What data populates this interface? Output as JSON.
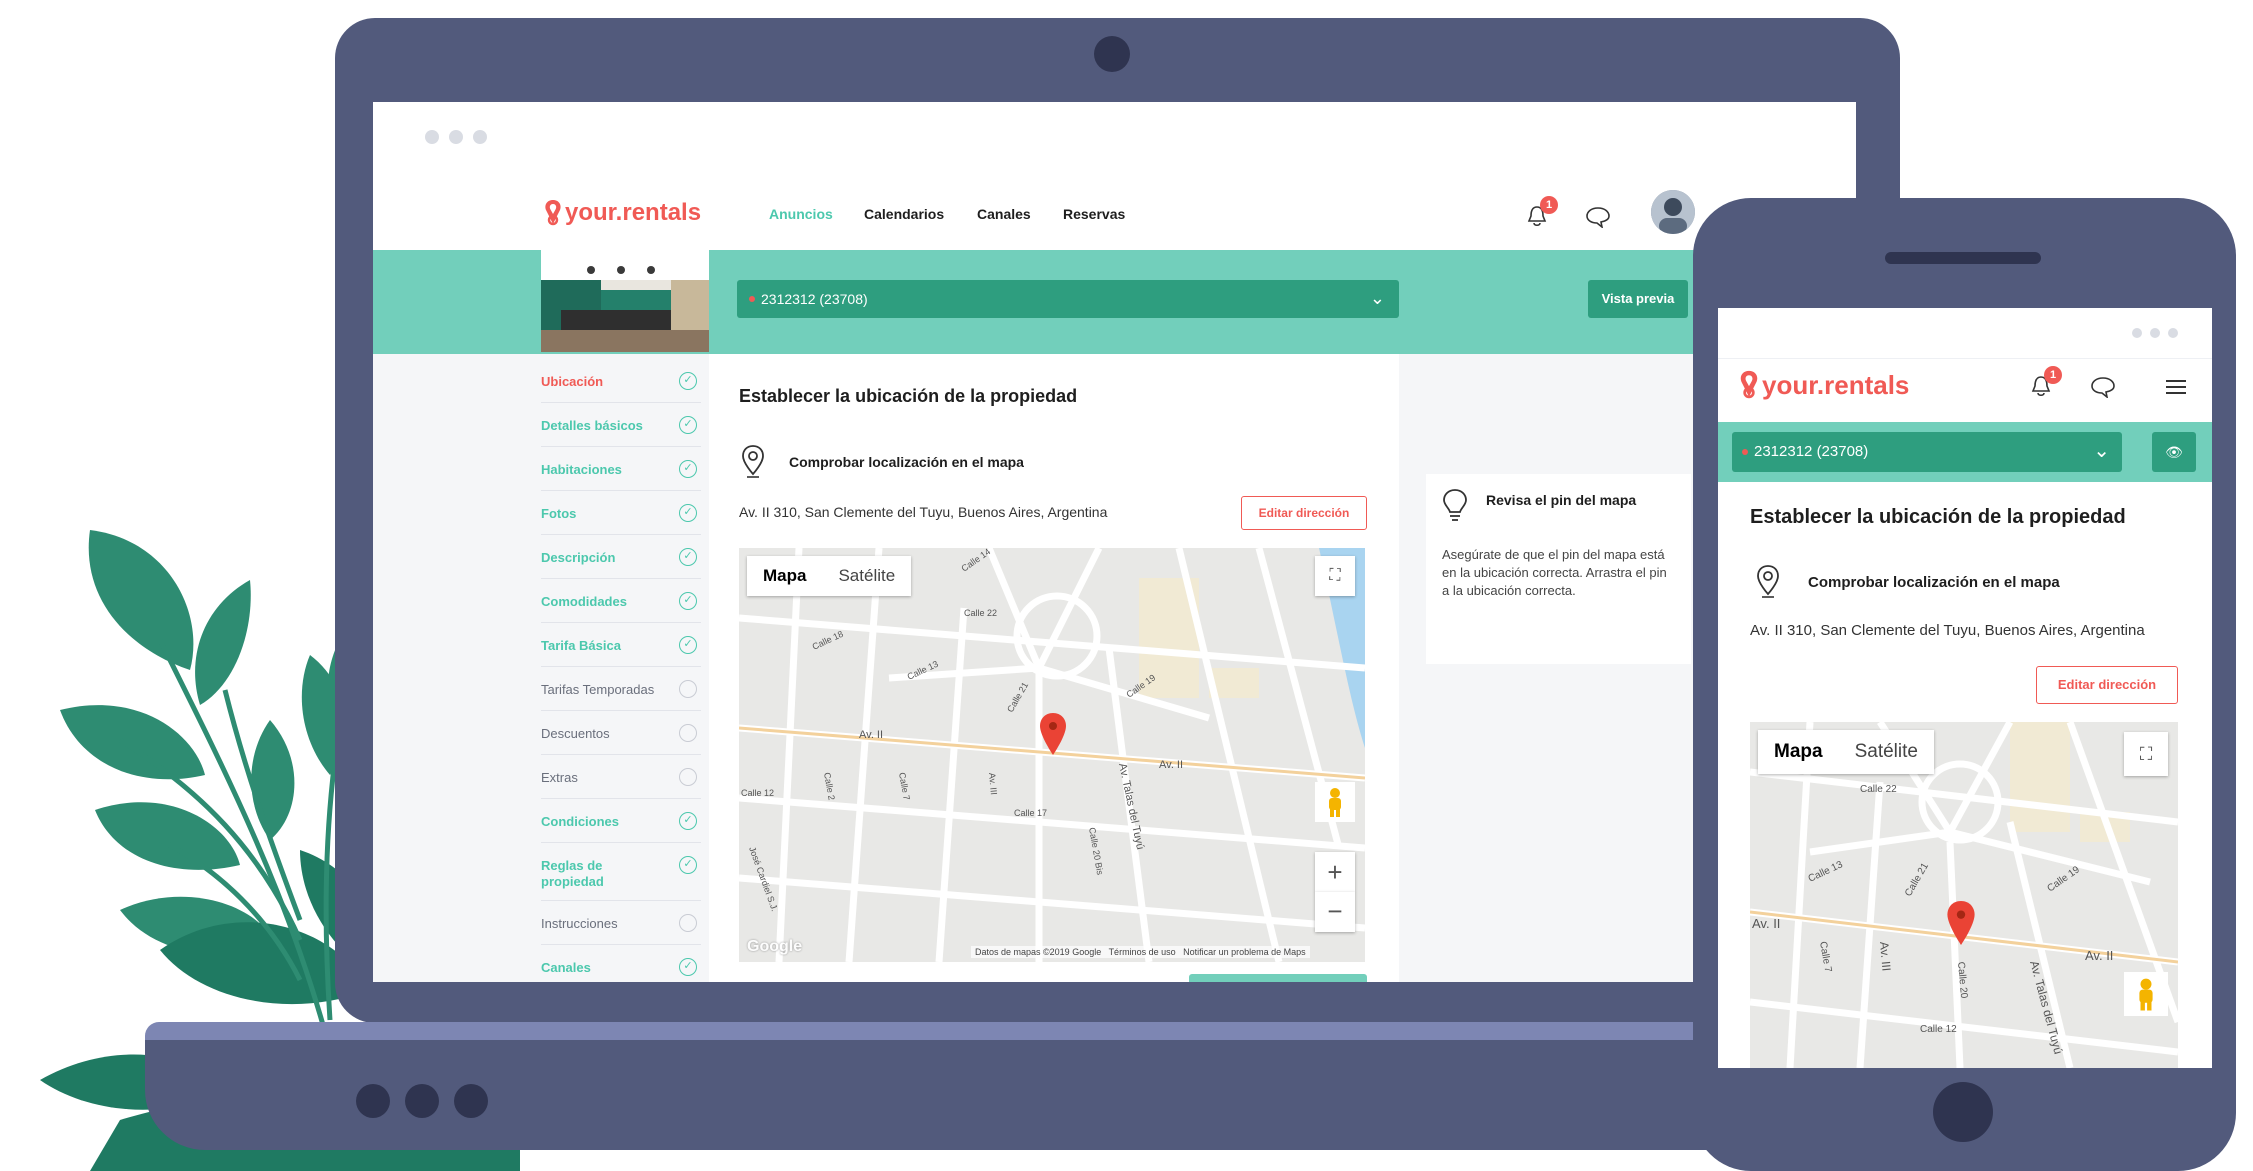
{
  "brand": {
    "name": "your.rentals",
    "accent": "#f05a55",
    "teal": "#4cc8ad",
    "teal_dark": "#2e9e7f",
    "device": "#525a7c"
  },
  "nav": {
    "links": [
      "Anuncios",
      "Calendarios",
      "Canales",
      "Reservas"
    ],
    "active": "Anuncios",
    "notification_count": "1"
  },
  "property_select": {
    "value": "2312312 (23708)"
  },
  "preview_button": "Vista previa",
  "sidebar": {
    "items": [
      {
        "label": "Ubicación",
        "state": "current"
      },
      {
        "label": "Detalles básicos",
        "state": "done"
      },
      {
        "label": "Habitaciones",
        "state": "done"
      },
      {
        "label": "Fotos",
        "state": "done"
      },
      {
        "label": "Descripción",
        "state": "done"
      },
      {
        "label": "Comodidades",
        "state": "done"
      },
      {
        "label": "Tarifa Básica",
        "state": "done"
      },
      {
        "label": "Tarifas Temporadas",
        "state": "pending"
      },
      {
        "label": "Descuentos",
        "state": "pending"
      },
      {
        "label": "Extras",
        "state": "pending"
      },
      {
        "label": "Condiciones",
        "state": "done"
      },
      {
        "label": "Reglas de propiedad",
        "state": "done"
      },
      {
        "label": "Instrucciones",
        "state": "pending"
      },
      {
        "label": "Canales",
        "state": "done"
      }
    ]
  },
  "main": {
    "title": "Establecer la ubicación de la propiedad",
    "check_label": "Comprobar localización en el mapa",
    "address": "Av. II 310, San Clemente del Tuyu, Buenos Aires, Argentina",
    "edit_button": "Editar dirección"
  },
  "map": {
    "tab_map": "Mapa",
    "tab_satellite": "Satélite",
    "zoom_in": "+",
    "zoom_out": "−",
    "attribution": "Datos de mapas ©2019 Google",
    "terms": "Términos de uso",
    "report": "Notificar un problema de Maps",
    "google": "Google",
    "streets": {
      "calle14": "Calle 14",
      "calle22": "Calle 22",
      "calle18": "Calle 18",
      "calle13": "Calle 13",
      "calle21": "Calle 21",
      "calle19": "Calle 19",
      "av2": "Av. II",
      "av2b": "Av. II",
      "calle12": "Calle 12",
      "calle17": "Calle 17",
      "calle2": "Calle 2",
      "calle7": "Calle 7",
      "av3": "Av. III",
      "calle20": "Calle 20 Bis",
      "talas": "Av. Talas del Tuyú",
      "jose": "José Cardiel S.J."
    }
  },
  "tip": {
    "title": "Revisa el pin del mapa",
    "body": "Asegúrate de que el pin del mapa está en la ubicación correcta. Arrastra el pin a la ubicación correcta."
  },
  "phone": {
    "title": "Establecer la ubicación de la propiedad",
    "check_label": "Comprobar localización en el mapa",
    "address": "Av. II 310, San Clemente del Tuyu, Buenos Aires, Argentina",
    "edit_button": "Editar dirección",
    "streets": {
      "calle22": "Calle 22",
      "calle13": "Calle 13",
      "calle21": "Calle 21",
      "calle19": "Calle 19",
      "av2": "Av. II",
      "av2b": "Av. II",
      "calle7": "Calle 7",
      "av3": "Av. III",
      "calle12": "Calle 12",
      "talas": "Av. Talas del Tuyú",
      "calle20": "Calle 20"
    }
  }
}
